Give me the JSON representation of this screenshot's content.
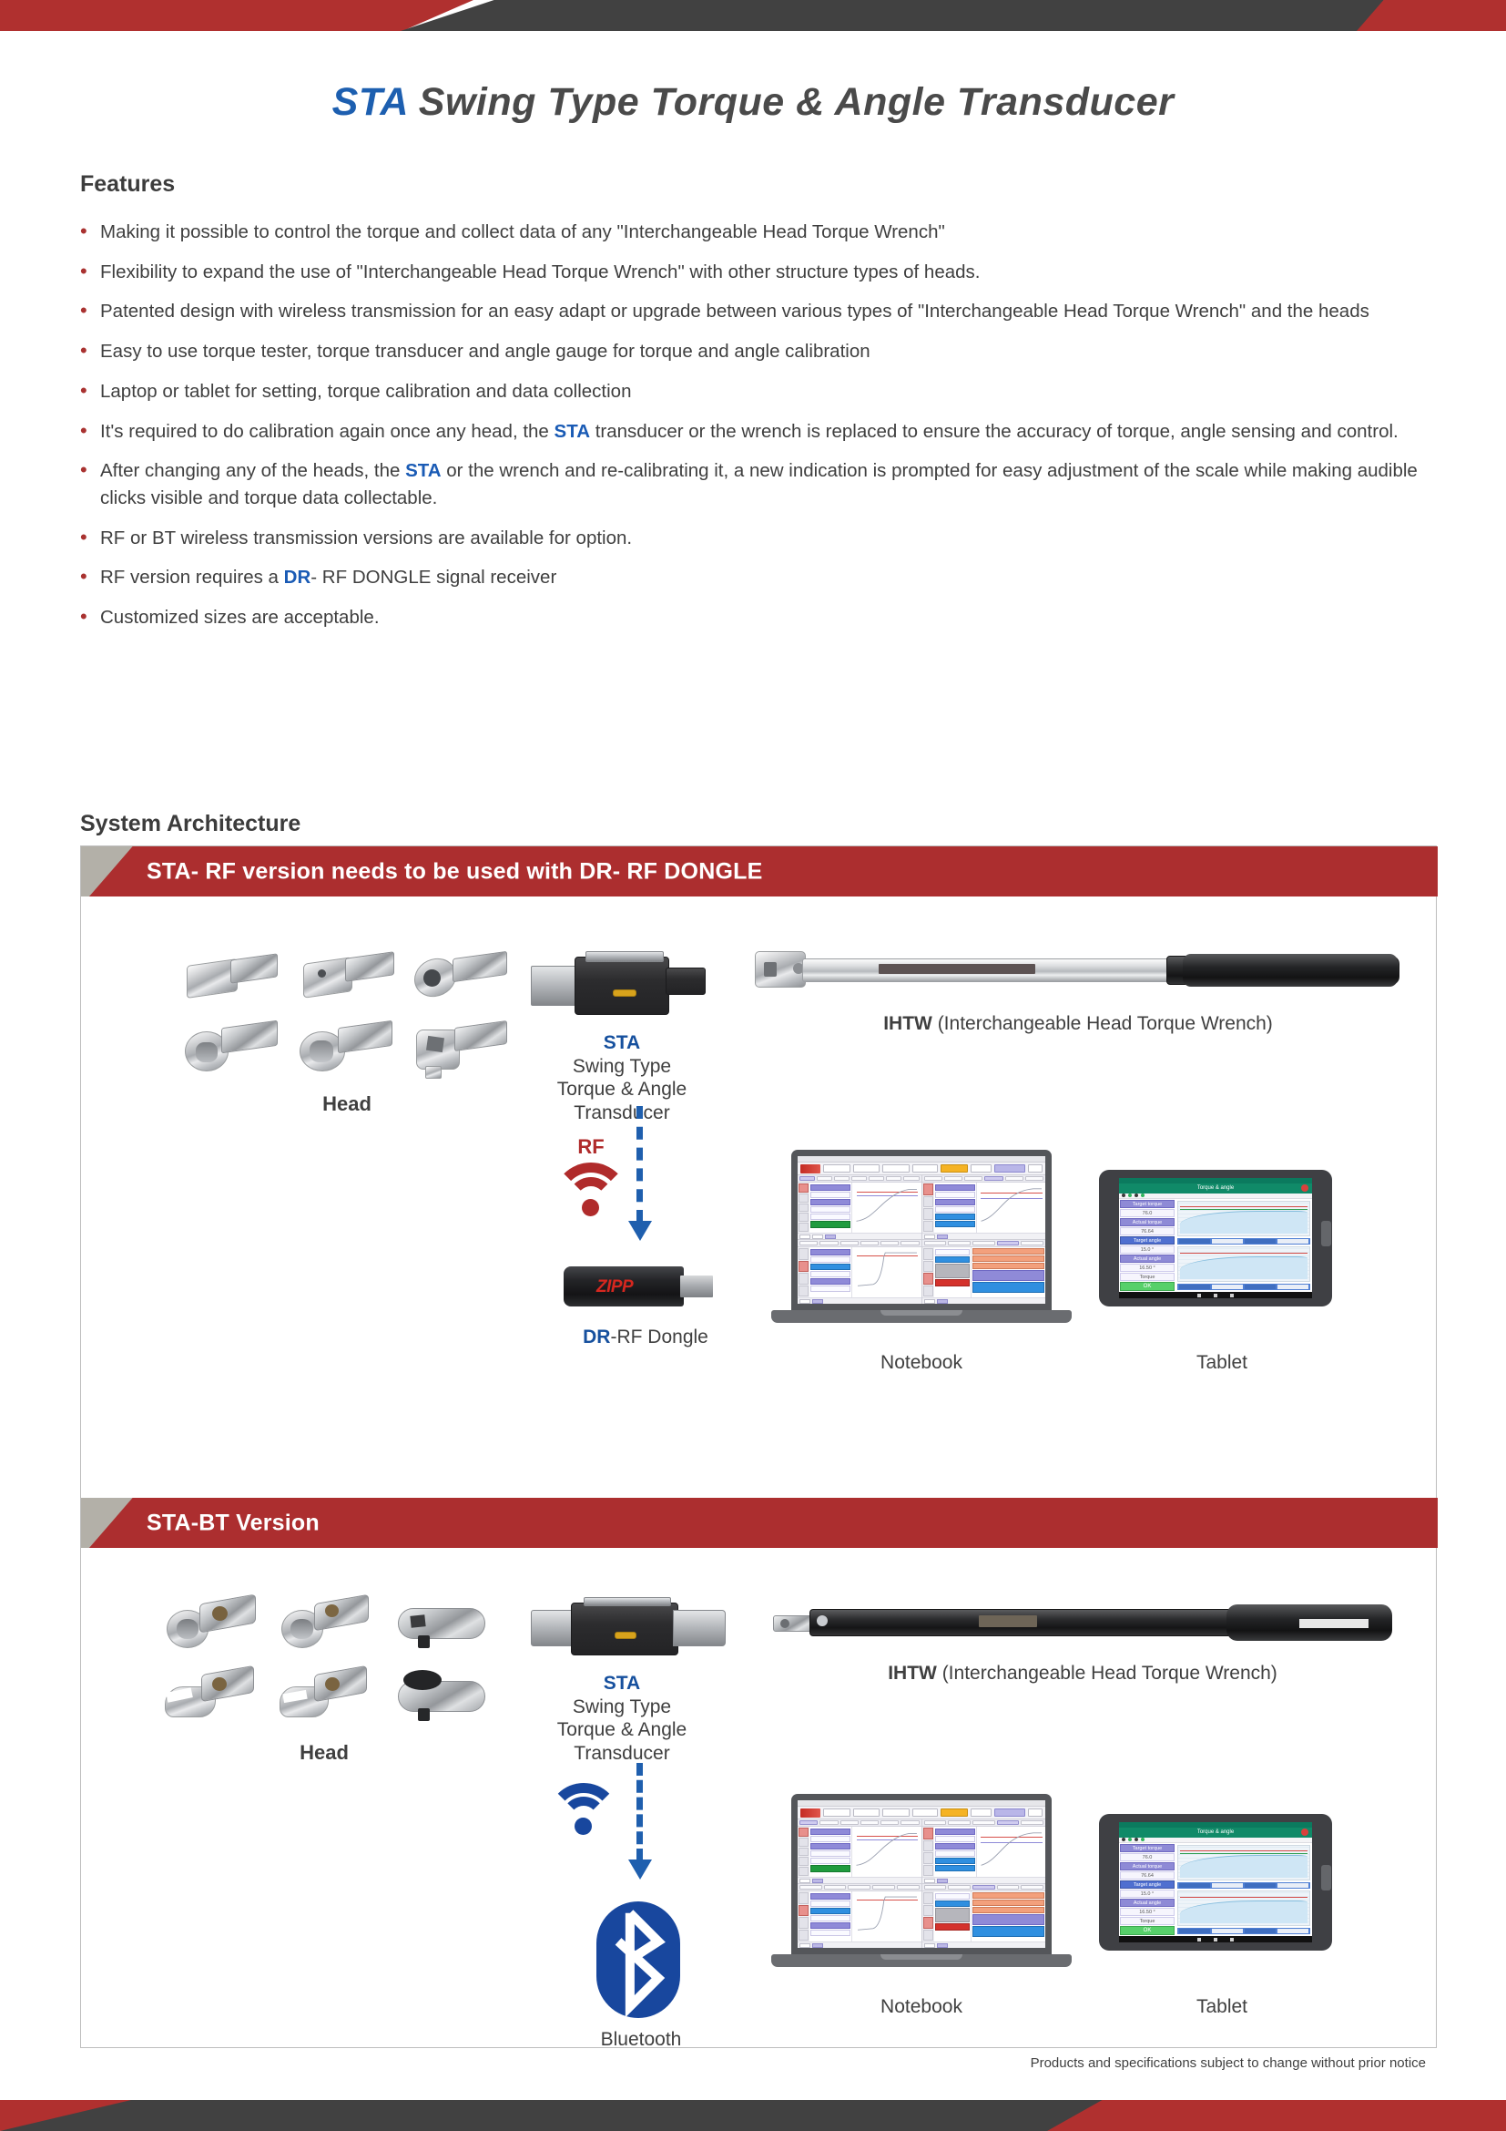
{
  "title": {
    "prefix_hl": "STA",
    "rest": " Swing Type Torque & Angle Transducer",
    "full": "STA Swing Type Torque & Angle Transducer"
  },
  "sections": {
    "features_heading": "Features",
    "system_architecture_heading": "System Architecture"
  },
  "features": [
    {
      "text": "Making it possible to control the torque and collect data of any \"Interchangeable Head Torque Wrench\""
    },
    {
      "text": "Flexibility to expand the use of \"Interchangeable Head Torque Wrench\" with other structure types of heads."
    },
    {
      "text": "Patented design with wireless transmission for an easy adapt or upgrade between various types of \"Interchangeable Head Torque Wrench\" and the heads"
    },
    {
      "text": "Easy to use torque tester, torque transducer and angle gauge for torque and angle calibration"
    },
    {
      "text": "Laptop or tablet for setting, torque calibration and data collection"
    },
    {
      "pre": "It's required to do calibration again once any head, the ",
      "hl": "STA",
      "post": " transducer or the wrench is replaced to ensure the accuracy of torque, angle sensing and control."
    },
    {
      "pre": "After changing any of the heads, the ",
      "hl": "STA",
      "post": " or the wrench and re-calibrating it, a new indication is prompted for easy adjustment of the scale while making audible clicks visible and torque data collectable."
    },
    {
      "text": "RF or BT wireless transmission versions are available for option."
    },
    {
      "pre": "RF version requires a ",
      "hl": "DR",
      "post": "- RF DONGLE signal receiver"
    },
    {
      "text": "Customized sizes are acceptable."
    }
  ],
  "architecture": {
    "rf": {
      "banner": "STA- RF version needs to be used with DR- RF DONGLE",
      "head_label": "Head",
      "sta_name": "STA",
      "sta_desc_line1": "Swing Type",
      "sta_desc_line2": "Torque & Angle",
      "sta_desc_line3": "Transducer",
      "ihtw_abbr": "IHTW",
      "ihtw_full": "(Interchangeable Head Torque Wrench)",
      "signal_label": "RF",
      "dongle_brand": "ZIPP",
      "dongle_label_hl": "DR",
      "dongle_label_rest": "-RF Dongle",
      "notebook_label": "Notebook",
      "tablet_label": "Tablet"
    },
    "bt": {
      "banner": "STA-BT Version",
      "head_label": "Head",
      "sta_name": "STA",
      "sta_desc_line1": "Swing Type",
      "sta_desc_line2": "Torque & Angle",
      "sta_desc_line3": "Transducer",
      "ihtw_abbr": "IHTW",
      "ihtw_full": "(Interchangeable Head Torque Wrench)",
      "signal_label": "Bluetooth",
      "notebook_label": "Notebook",
      "tablet_label": "Tablet"
    },
    "tablet_app": {
      "app_title": "Torque & angle",
      "target_torque_label": "Target torque",
      "target_torque_value": "76.0",
      "actual_torque_label": "Actual torque",
      "actual_torque_value": "76.64",
      "target_angle_label": "Target angle",
      "target_angle_value": "15.0 °",
      "actual_angle_label": "Actual angle",
      "actual_angle_value": "16.50 °",
      "torque_label": "Torque",
      "status_ok": "OK"
    }
  },
  "footer": {
    "note": "Products and specifications subject to change without prior notice"
  },
  "colors": {
    "brand_red": "#b0302f",
    "banner_red": "#ac2e2f",
    "dark_gray": "#414141",
    "accent_blue": "#1a5bb5",
    "bluetooth_blue": "#18479e",
    "rf_red": "#b02b2b"
  }
}
